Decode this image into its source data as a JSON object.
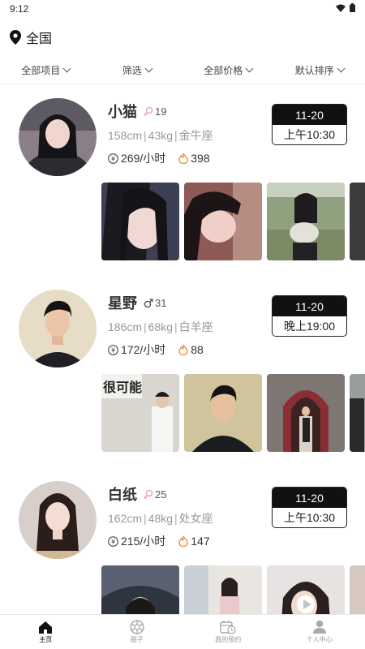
{
  "status": {
    "time": "9:12"
  },
  "location": {
    "label": "全国"
  },
  "filters": [
    {
      "label": "全部项目"
    },
    {
      "label": "筛选"
    },
    {
      "label": "全部价格"
    },
    {
      "label": "默认排序"
    }
  ],
  "profiles": [
    {
      "name": "小猫",
      "gender": "female",
      "age": "19",
      "height": "158cm",
      "weight": "43kg",
      "zodiac": "金牛座",
      "price": "269/小时",
      "heat": "398",
      "date": "11-20",
      "time": "上午10:30"
    },
    {
      "name": "星野",
      "gender": "male",
      "age": "31",
      "height": "186cm",
      "weight": "68kg",
      "zodiac": "白羊座",
      "price": "172/小时",
      "heat": "88",
      "date": "11-20",
      "time": "晚上19:00",
      "photo_caption": "很可能"
    },
    {
      "name": "白纸",
      "gender": "female",
      "age": "25",
      "height": "162cm",
      "weight": "48kg",
      "zodiac": "处女座",
      "price": "215/小时",
      "heat": "147",
      "date": "11-20",
      "time": "上午10:30"
    }
  ],
  "tabs": [
    {
      "label": "主页",
      "icon": "home-icon"
    },
    {
      "label": "圈子",
      "icon": "aperture-icon"
    },
    {
      "label": "我的预约",
      "icon": "calendar-clock-icon"
    },
    {
      "label": "个人中心",
      "icon": "person-icon"
    }
  ],
  "colors": {
    "female": "#e8a0c0",
    "male": "#555555",
    "heat": "#f08a24",
    "dark": "#111111"
  }
}
